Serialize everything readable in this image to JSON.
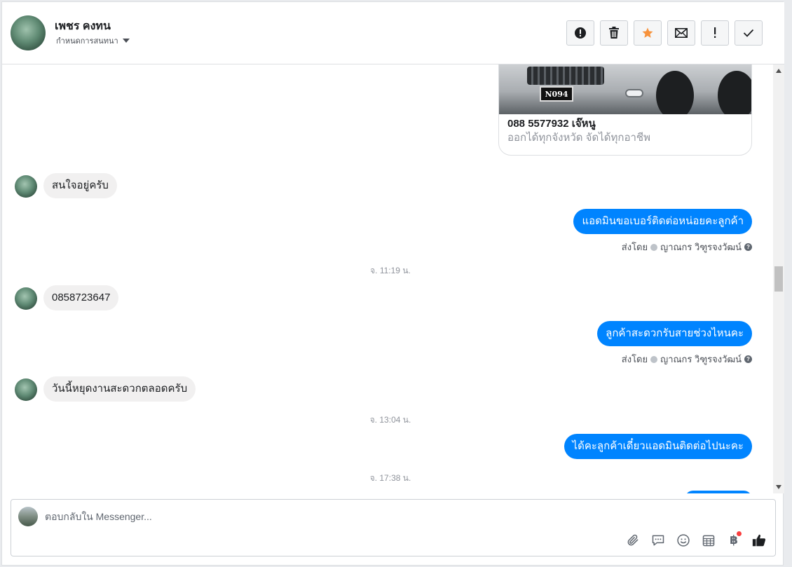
{
  "header": {
    "contact_name": "เพชร คงทน",
    "assign_label": "กำหนดการสนทนา",
    "actions": [
      {
        "name": "spam-icon"
      },
      {
        "name": "trash-icon"
      },
      {
        "name": "star-icon"
      },
      {
        "name": "mail-icon"
      },
      {
        "name": "exclamation-icon"
      },
      {
        "name": "check-icon"
      }
    ]
  },
  "card": {
    "plate": "N094",
    "title": "088 5577932 เจ๊หนู",
    "subtitle": "ออกได้ทุกจังหวัด จัดได้ทุกอาชีพ"
  },
  "messages": {
    "m1": "สนใจอยู่ครับ",
    "m2": "แอดมินขอเบอร์ติดต่อหน่อยคะลูกค้า",
    "m3": "0858723647",
    "m4": "ลูกค้าสะดวกรับสายช่วงไหนคะ",
    "m5": "วันนี้หยุดงานสะดวกตลอดครับ",
    "m6": "ได้คะลูกค้าเดี๋ยวแอดมินติดต่อไปนะคะ"
  },
  "sent_by": {
    "label": "ส่งโดย",
    "agent": "ญาณกร วิฑูรจงวัฒน์"
  },
  "timestamps": {
    "t1": "จ. 11:19 น.",
    "t2": "จ. 13:04 น.",
    "t3": "จ. 17:38 น."
  },
  "composer": {
    "placeholder": "ตอบกลับใน Messenger...",
    "baht_symbol": "฿"
  },
  "colors": {
    "outgoing_bubble": "#0084ff",
    "incoming_bubble": "#f1f0f0",
    "star": "#f7923b"
  }
}
